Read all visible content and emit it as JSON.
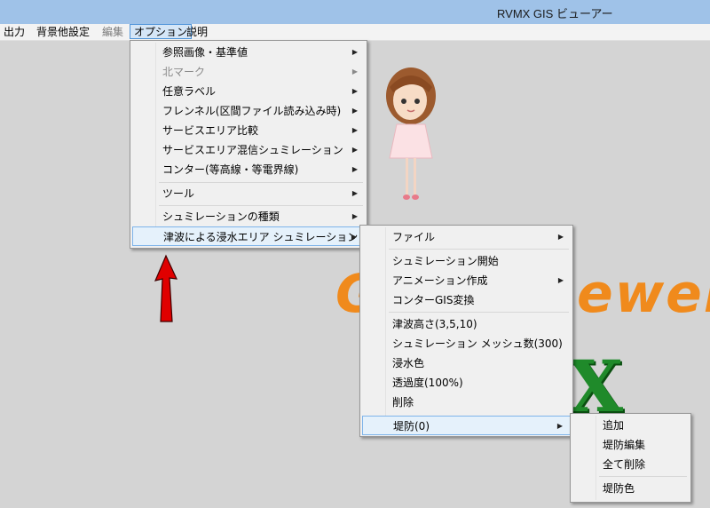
{
  "window": {
    "title": "RVMX GIS ビューアー"
  },
  "menubar": [
    {
      "label": "出力",
      "state": "normal"
    },
    {
      "label": "背景他設定",
      "state": "normal"
    },
    {
      "label": "編集",
      "state": "disabled"
    },
    {
      "label": "オプション",
      "state": "active"
    },
    {
      "label": "説明",
      "state": "normal"
    }
  ],
  "options_menu": [
    {
      "label": "参照画像・基準値",
      "submenu": true
    },
    {
      "label": "北マーク",
      "submenu": true,
      "disabled": true
    },
    {
      "label": "任意ラベル",
      "submenu": true
    },
    {
      "label": "フレンネル(区間ファイル読み込み時)",
      "submenu": true
    },
    {
      "label": "サービスエリア比較",
      "submenu": true
    },
    {
      "label": "サービスエリア混信シュミレーション",
      "submenu": true
    },
    {
      "label": "コンター(等高線・等電界線)",
      "submenu": true
    },
    {
      "label": "ツール",
      "submenu": true
    },
    {
      "label": "シュミレーションの種類",
      "submenu": true
    },
    {
      "label": "津波による浸水エリア シュミレーション",
      "submenu": true,
      "highlighted": true
    }
  ],
  "tsunami_menu": [
    {
      "label": "ファイル",
      "submenu": true
    },
    {
      "label": "シュミレーション開始"
    },
    {
      "label": "アニメーション作成",
      "submenu": true
    },
    {
      "label": "コンターGIS変換"
    },
    {
      "label": "津波高さ(3,5,10)"
    },
    {
      "label": "シュミレーション メッシュ数(300)"
    },
    {
      "label": "浸水色"
    },
    {
      "label": "透過度(100%)"
    },
    {
      "label": "削除"
    },
    {
      "label": "堤防(0)",
      "submenu": true,
      "highlighted": true
    }
  ],
  "levee_menu": [
    {
      "label": "追加"
    },
    {
      "label": "堤防編集"
    },
    {
      "label": "全て削除"
    },
    {
      "label": "堤防色"
    }
  ],
  "background": {
    "logo_text_left": "G",
    "logo_text_right": "ewer",
    "logo_x": "X",
    "logo_color": "#f08a1c",
    "logo_x_color": "#1f8a2a",
    "annotation_arrow_color": "#e00000"
  },
  "submenu_arrow": "▶"
}
